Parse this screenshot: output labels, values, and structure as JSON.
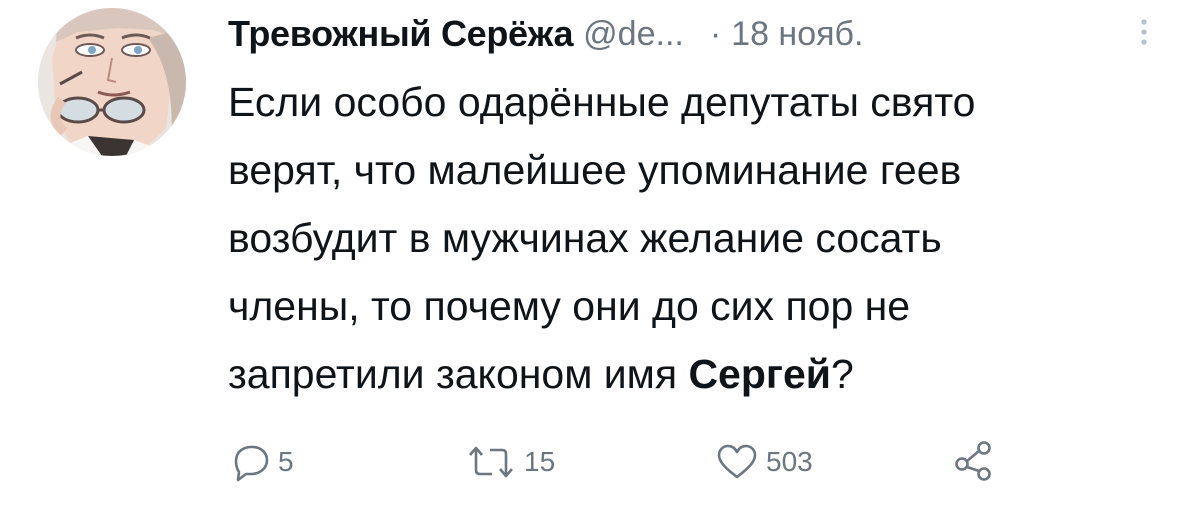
{
  "tweet": {
    "display_name": "Тревожный Серёжа",
    "handle": "@de...",
    "separator": "·",
    "date": "18 нояб.",
    "text_lines": [
      "Если особо одарённые депутаты свято",
      "верят, что малейшее упоминание геев",
      "возбудит в мужчинах желание сосать",
      "члены, то почему они до сих пор не"
    ],
    "last_line_prefix": "запретили законом имя ",
    "last_line_bold": "Сергей",
    "last_line_suffix": "?"
  },
  "actions": {
    "reply_icon": "reply-icon",
    "reply_count": "5",
    "retweet_icon": "retweet-icon",
    "retweet_count": "15",
    "like_icon": "heart-icon",
    "like_count": "503",
    "share_icon": "share-icon",
    "more_icon": "vertical-dots-icon"
  },
  "colors": {
    "text": "#0f1419",
    "secondary": "#6b7680",
    "background": "#ffffff"
  }
}
